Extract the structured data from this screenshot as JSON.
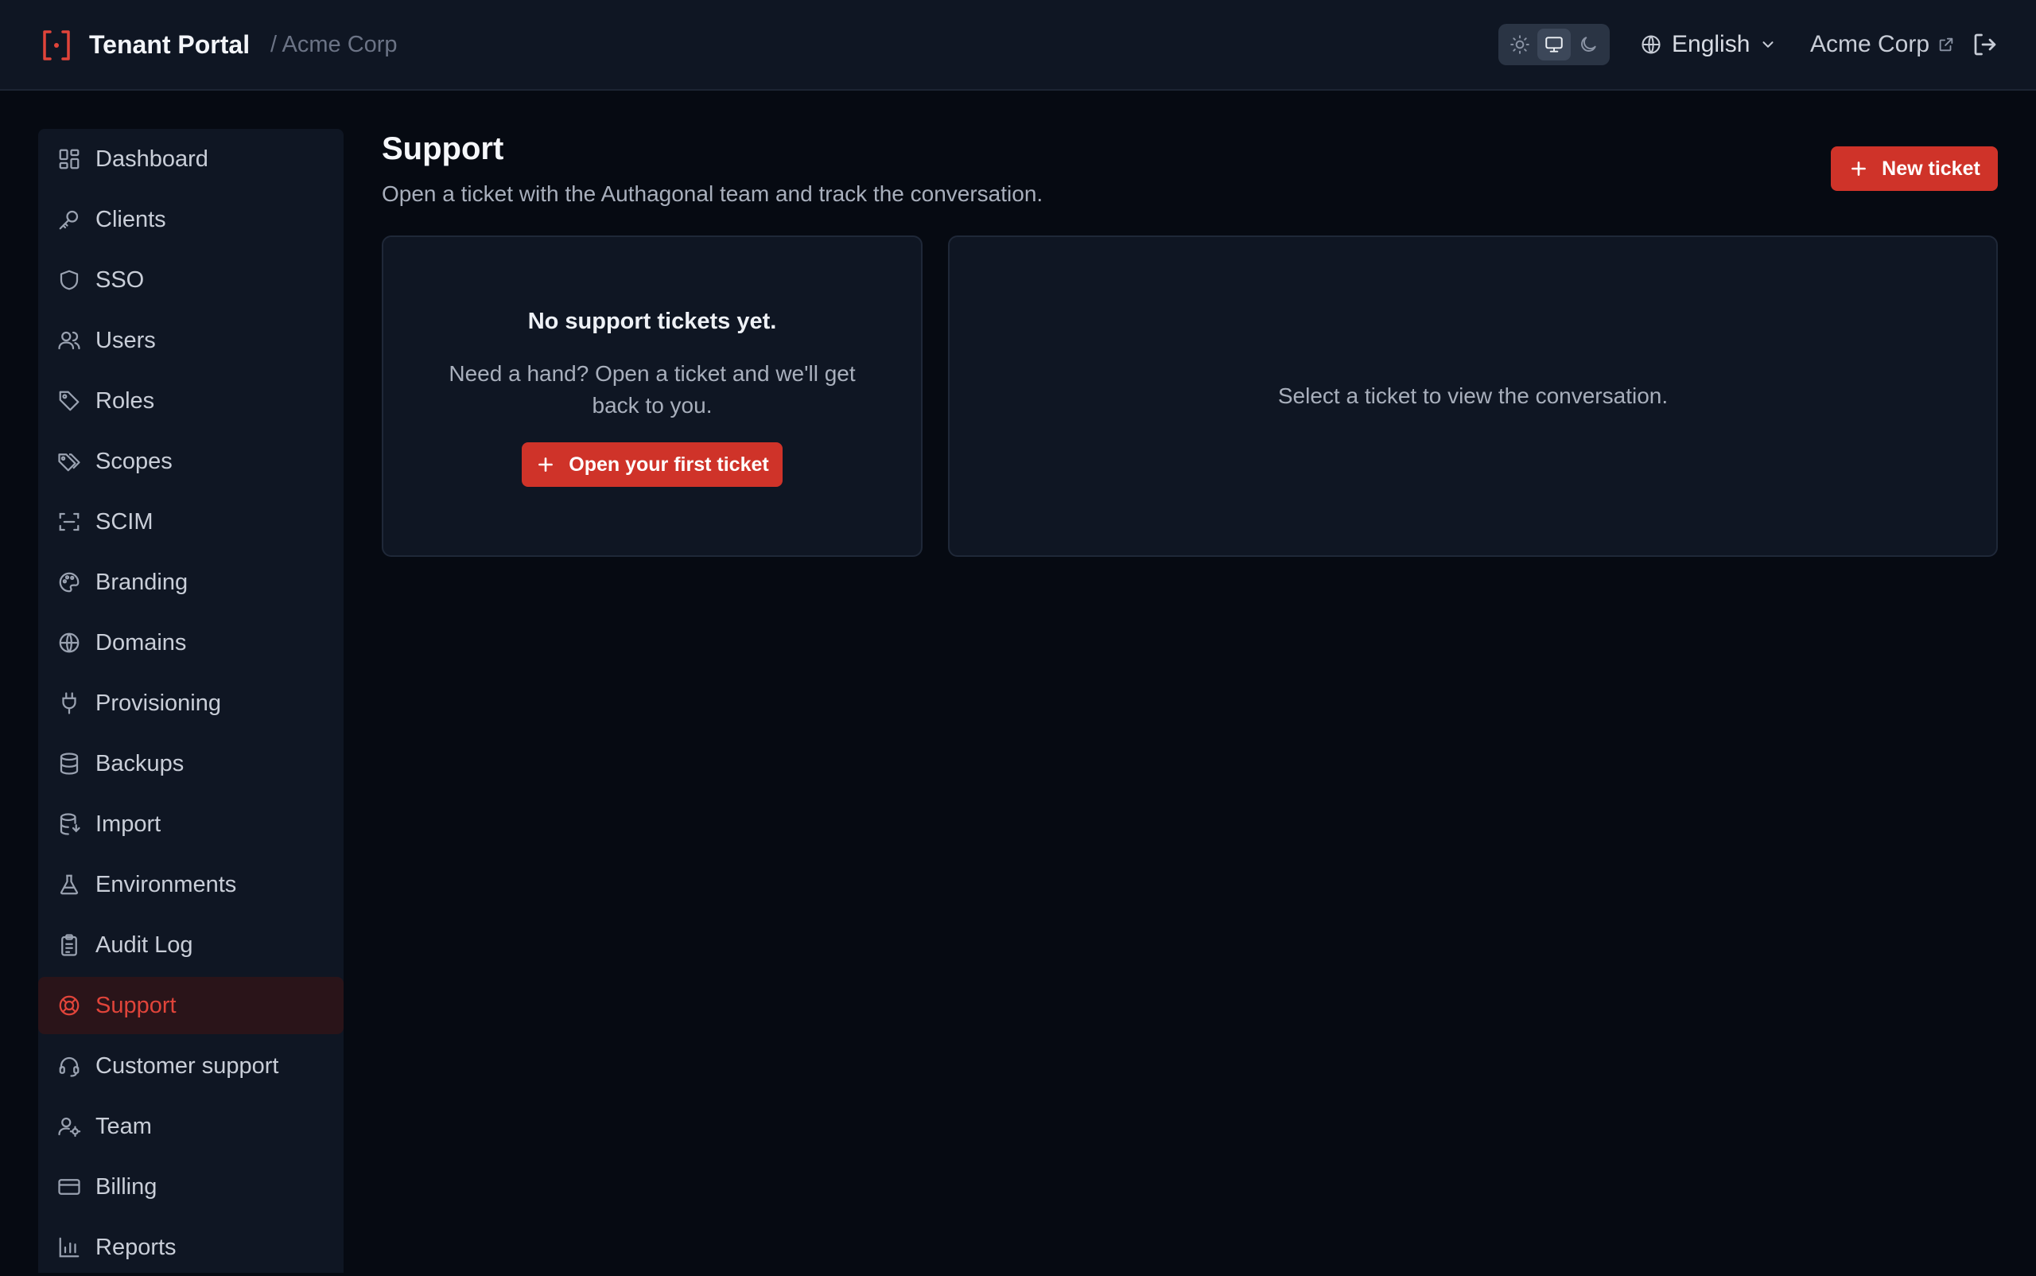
{
  "header": {
    "app_title": "Tenant Portal",
    "breadcrumb": "/ Acme Corp",
    "theme_options": [
      "light",
      "system",
      "dark"
    ],
    "theme_selected": "system",
    "language": "English",
    "org_name": "Acme Corp"
  },
  "sidebar": {
    "items": [
      {
        "label": "Dashboard",
        "icon": "dashboard-icon"
      },
      {
        "label": "Clients",
        "icon": "key-icon"
      },
      {
        "label": "SSO",
        "icon": "shield-icon"
      },
      {
        "label": "Users",
        "icon": "users-icon"
      },
      {
        "label": "Roles",
        "icon": "tag-icon"
      },
      {
        "label": "Scopes",
        "icon": "tags-icon"
      },
      {
        "label": "SCIM",
        "icon": "scan-icon"
      },
      {
        "label": "Branding",
        "icon": "palette-icon"
      },
      {
        "label": "Domains",
        "icon": "globe-icon"
      },
      {
        "label": "Provisioning",
        "icon": "plug-icon"
      },
      {
        "label": "Backups",
        "icon": "database-icon"
      },
      {
        "label": "Import",
        "icon": "database-import-icon"
      },
      {
        "label": "Environments",
        "icon": "flask-icon"
      },
      {
        "label": "Audit Log",
        "icon": "clipboard-icon"
      },
      {
        "label": "Support",
        "icon": "lifebuoy-icon"
      },
      {
        "label": "Customer support",
        "icon": "headset-icon"
      },
      {
        "label": "Team",
        "icon": "user-cog-icon"
      },
      {
        "label": "Billing",
        "icon": "credit-card-icon"
      },
      {
        "label": "Reports",
        "icon": "bar-chart-icon"
      }
    ],
    "active": "Support"
  },
  "main": {
    "title": "Support",
    "subtitle": "Open a ticket with the Authagonal team and track the conversation.",
    "new_ticket_label": "New ticket",
    "empty_title": "No support tickets yet.",
    "empty_text": "Need a hand? Open a ticket and we'll get back to you.",
    "first_ticket_label": "Open your first ticket",
    "conversation_hint": "Select a ticket to view the conversation."
  },
  "colors": {
    "accent": "#cf3329",
    "background": "#060a12",
    "panel": "#0f1623"
  }
}
